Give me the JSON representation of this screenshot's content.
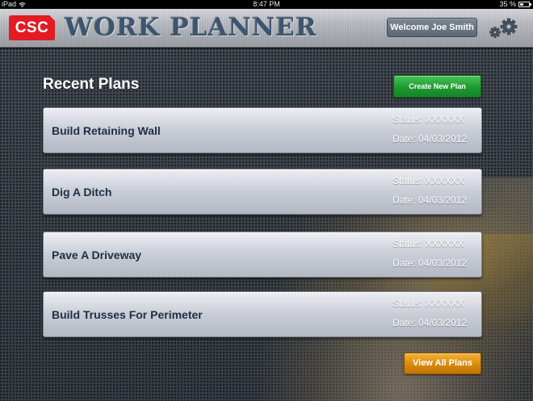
{
  "status_bar": {
    "device": "iPad",
    "time": "8:47 PM",
    "battery": "35 %",
    "battery_level": 0.35
  },
  "header": {
    "logo_text": "CSC",
    "app_title": "WORK PLANNER",
    "welcome_text": "Welcome Joe Smith",
    "settings_icon": "gear-icon"
  },
  "main": {
    "section_title": "Recent Plans",
    "create_button": "Create New Plan",
    "view_all_button": "View All Plans",
    "plans": [
      {
        "name": "Build Retaining Wall",
        "status": "Status: XXXXXX",
        "date": "Date: 04/03/2012"
      },
      {
        "name": "Dig A Ditch",
        "status": "Status: XXXXXX",
        "date": "Date: 04/03/2012"
      },
      {
        "name": "Pave A Driveway",
        "status": "Status: XXXXXX",
        "date": "Date: 04/03/2012"
      },
      {
        "name": "Build Trusses For Perimeter",
        "status": "Status: XXXXXX",
        "date": "Date: 04/03/2012"
      }
    ]
  },
  "colors": {
    "brand_red": "#e31b23",
    "title_blue": "#3d5570",
    "create_green": "#1f9a30",
    "view_all_orange": "#d98a0a"
  }
}
